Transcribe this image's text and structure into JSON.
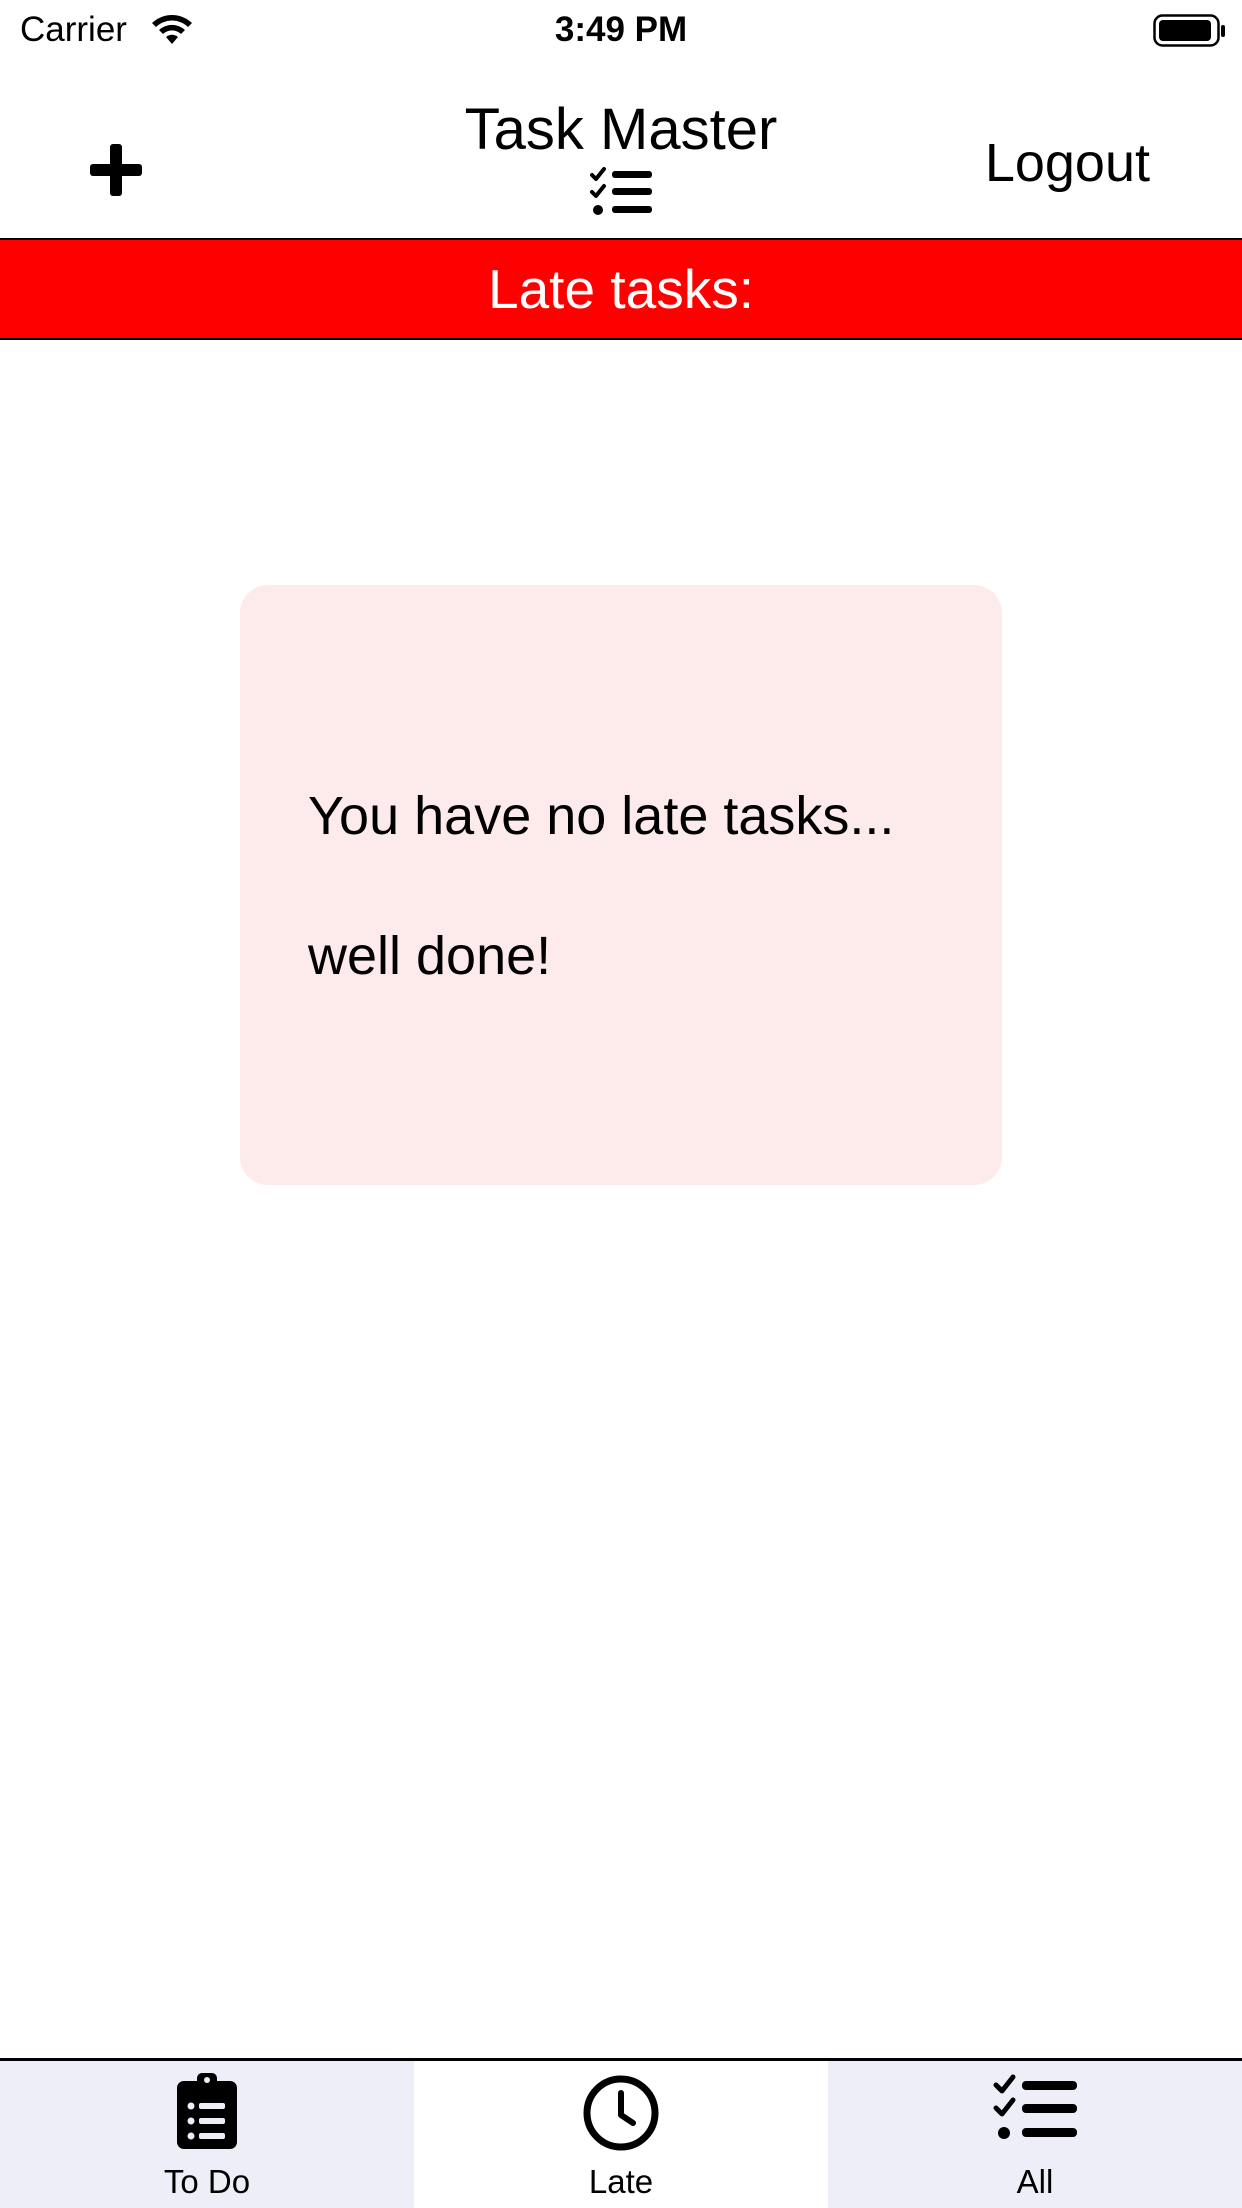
{
  "status": {
    "carrier": "Carrier",
    "time": "3:49 PM"
  },
  "header": {
    "title": "Task Master",
    "logout_label": "Logout"
  },
  "banner": {
    "text": "Late tasks:"
  },
  "empty_state": {
    "line1": "You have no late tasks...",
    "line2": "well done!"
  },
  "tabs": [
    {
      "label": "To Do",
      "icon": "clipboard-list-icon",
      "active": false
    },
    {
      "label": "Late",
      "icon": "clock-icon",
      "active": true
    },
    {
      "label": "All",
      "icon": "checklist-icon",
      "active": false
    }
  ],
  "colors": {
    "banner": "#ff0000",
    "card": "#fdeaea",
    "tab_inactive": "#eeeef8"
  }
}
